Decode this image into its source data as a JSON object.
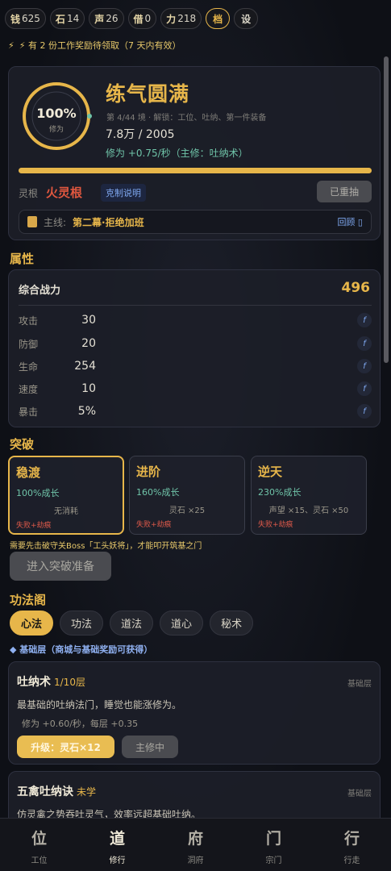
{
  "topbar": {
    "resources": [
      {
        "key": "钱",
        "value": "625"
      },
      {
        "key": "石",
        "value": "14"
      },
      {
        "key": "声",
        "value": "26"
      },
      {
        "key": "借",
        "value": "0"
      },
      {
        "key": "力",
        "value": "218"
      }
    ],
    "archive_label": "档",
    "settings_label": "设"
  },
  "notice": {
    "icon": "⚡",
    "text": "⚡ 有 2 份工作奖励待领取（7 天内有效）"
  },
  "realm": {
    "percent": "100%",
    "ring_label": "修为",
    "progress_fraction": 1.0,
    "title": "练气圆满",
    "info": "第 4/44 境 · 解锁：工位、吐纳、第一件装备",
    "exp": "7.8万 / 2005",
    "rate": "修为 +0.75/秒（主修：吐纳术）",
    "spirit_root_label": "灵根",
    "spirit_root_value": "火灵根",
    "restraint_label": "克制说明",
    "reroll_label": "已重抽",
    "mainline_prefix": "主线:",
    "mainline_text": "第二幕·拒绝加班",
    "review_label": "回顾 ▯"
  },
  "attributes": {
    "section_title": "属性",
    "power_label": "综合战力",
    "power_value": "496",
    "rows": [
      {
        "name": "攻击",
        "value": "30"
      },
      {
        "name": "防御",
        "value": "20"
      },
      {
        "name": "生命",
        "value": "254"
      },
      {
        "name": "速度",
        "value": "10"
      },
      {
        "name": "暴击",
        "value": "5%"
      }
    ],
    "formula_glyph": "f"
  },
  "breakthrough": {
    "section_title": "突破",
    "options": [
      {
        "title": "稳渡",
        "growth": "100%成长",
        "cost": "无消耗",
        "fail": "失败+劫痕"
      },
      {
        "title": "进阶",
        "growth": "160%成长",
        "cost": "灵石 ×25",
        "fail": "失败+劫痕"
      },
      {
        "title": "逆天",
        "growth": "230%成长",
        "cost": "声望 ×15、灵石 ×50",
        "fail": "失败+劫痕"
      }
    ],
    "note": "需要先击破守关Boss「工头妖将」，才能叩开筑基之门",
    "enter_label": "进入突破准备"
  },
  "techniques": {
    "section_title": "功法阁",
    "tabs": [
      "心法",
      "功法",
      "道法",
      "道心",
      "秘术"
    ],
    "layer_note": "◆ 基础层（商城与基础奖励可获得）",
    "items": [
      {
        "name": "吐纳术",
        "level": "1/10层",
        "tier": "基础层",
        "desc": "最基础的吐纳法门，睡觉也能涨修为。",
        "gain": "修为 +0.60/秒，每层 +0.35",
        "upgrade_label": "升级：灵石×12",
        "main_label": "主修中"
      },
      {
        "name": "五禽吐纳诀",
        "level": "未学",
        "tier": "基础层",
        "desc": "仿灵禽之势吞吐灵气，效率远超基础吐纳。"
      }
    ]
  },
  "bottomnav": [
    {
      "glyph": "位",
      "label": "工位"
    },
    {
      "glyph": "道",
      "label": "修行"
    },
    {
      "glyph": "府",
      "label": "洞府"
    },
    {
      "glyph": "门",
      "label": "宗门"
    },
    {
      "glyph": "行",
      "label": "行走"
    }
  ],
  "colors": {
    "accent": "#e7b64a",
    "teal": "#6fc3a8",
    "danger": "#e05a4a",
    "link": "#7fa8f0"
  }
}
